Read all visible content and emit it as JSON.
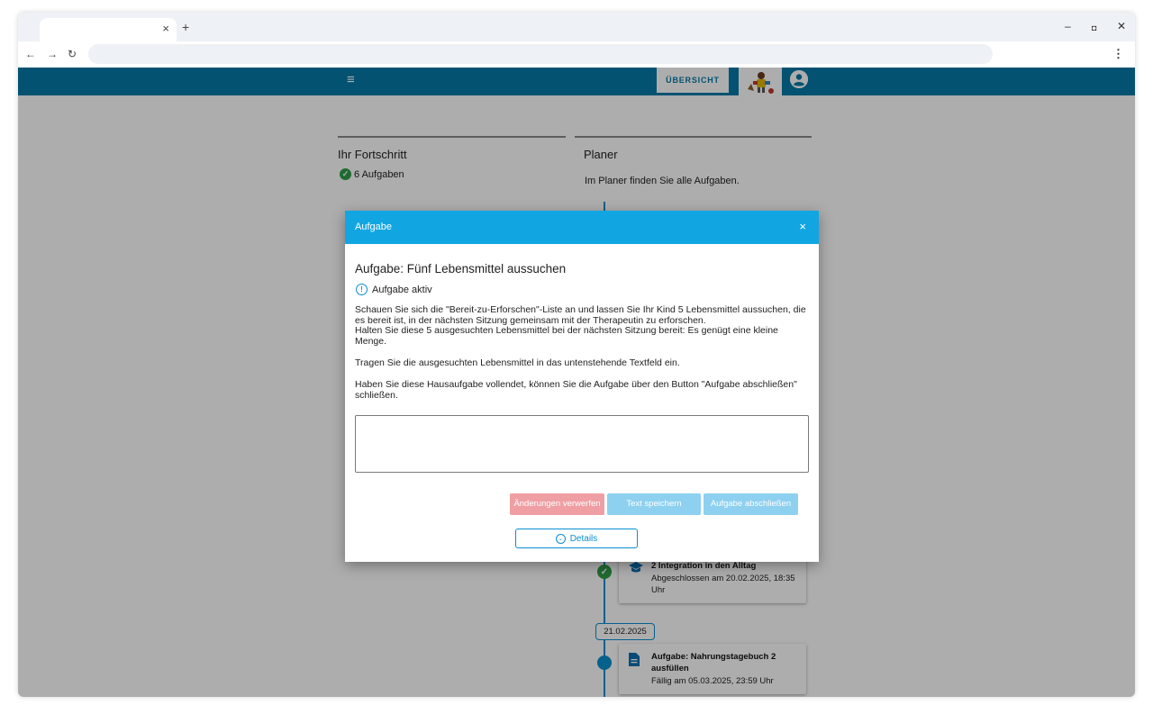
{
  "browser": {
    "tab_close": "×",
    "new_tab": "+",
    "back": "←",
    "forward": "→",
    "reload": "↻",
    "menu": "⋮",
    "minimize": "–",
    "restore": "◘",
    "close": "✕"
  },
  "appbar": {
    "menu_glyph": "≡",
    "overview_label": "ÜBERSICHT"
  },
  "progress": {
    "title": "Ihr Fortschritt",
    "tasks_count": "6 Aufgaben"
  },
  "planner": {
    "title": "Planer",
    "description": "Im Planer finden Sie alle Aufgaben.",
    "items": [
      {
        "title": "2 Integration in den Alltag",
        "subtitle": "Abgeschlossen am 20.02.2025, 18:35 Uhr",
        "status": "done"
      },
      {
        "title": "Aufgabe: Nahrungstagebuch 2 ausfüllen",
        "subtitle": "Fällig am 05.03.2025, 23:59 Uhr",
        "status": "open"
      }
    ],
    "date_chip": "21.02.2025"
  },
  "modal": {
    "header": "Aufgabe",
    "close_glyph": "×",
    "title": "Aufgabe: Fünf Lebensmittel aussuchen",
    "status": "Aufgabe aktiv",
    "paragraph1a": "Schauen Sie sich die \"Bereit-zu-Erforschen\"-Liste an und lassen Sie Ihr Kind 5 Lebensmittel aussuchen, die es bereit ist, in der nächsten Sitzung gemeinsam mit der Therapeutin zu erforschen.",
    "paragraph1b": "Halten Sie diese 5 ausgesuchten Lebensmittel bei der nächsten Sitzung bereit: Es genügt eine kleine Menge.",
    "paragraph2": "Tragen Sie die ausgesuchten Lebensmittel in das untenstehende Textfeld ein.",
    "paragraph3": "Haben Sie diese Hausaufgabe vollendet, können Sie die Aufgabe über den Button \"Aufgabe abschließen\" schließen.",
    "textarea_value": "",
    "btn_discard": "Änderungen verwerfen",
    "btn_save": "Text speichern",
    "btn_finish": "Aufgabe abschließen",
    "btn_details": "Details"
  },
  "colors": {
    "appbar": "#0779a8",
    "modal_header": "#11a6e2",
    "discard": "#ef9fa3",
    "save": "#8ed0ef",
    "success": "#2e9e47",
    "timeline": "#0a8fd0"
  }
}
